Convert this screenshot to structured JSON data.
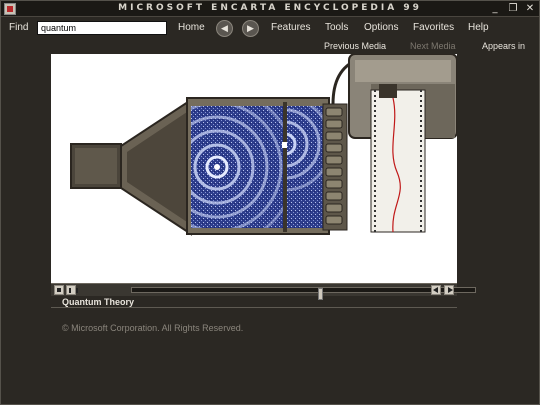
{
  "window": {
    "title": "MICROSOFT ENCARTA ENCYCLOPEDIA 99",
    "minimize": "_",
    "restore": "❐",
    "close": "✕"
  },
  "menu": {
    "find_label": "Find",
    "search_value": "quantum",
    "home": "Home",
    "back_glyph": "◀",
    "forward_glyph": "▶",
    "features": "Features",
    "tools": "Tools",
    "options": "Options",
    "favorites": "Favorites",
    "help": "Help"
  },
  "media_nav": {
    "previous": "Previous Media",
    "next": "Next Media",
    "appears_in": "Appears in"
  },
  "media": {
    "caption": "Quantum Theory",
    "progress": 0.55
  },
  "copyright": "© Microsoft Corporation. All Rights Reserved.",
  "colors": {
    "wave": "#2d3d8c",
    "metal": "#5e574a",
    "trace": "#c01818"
  }
}
